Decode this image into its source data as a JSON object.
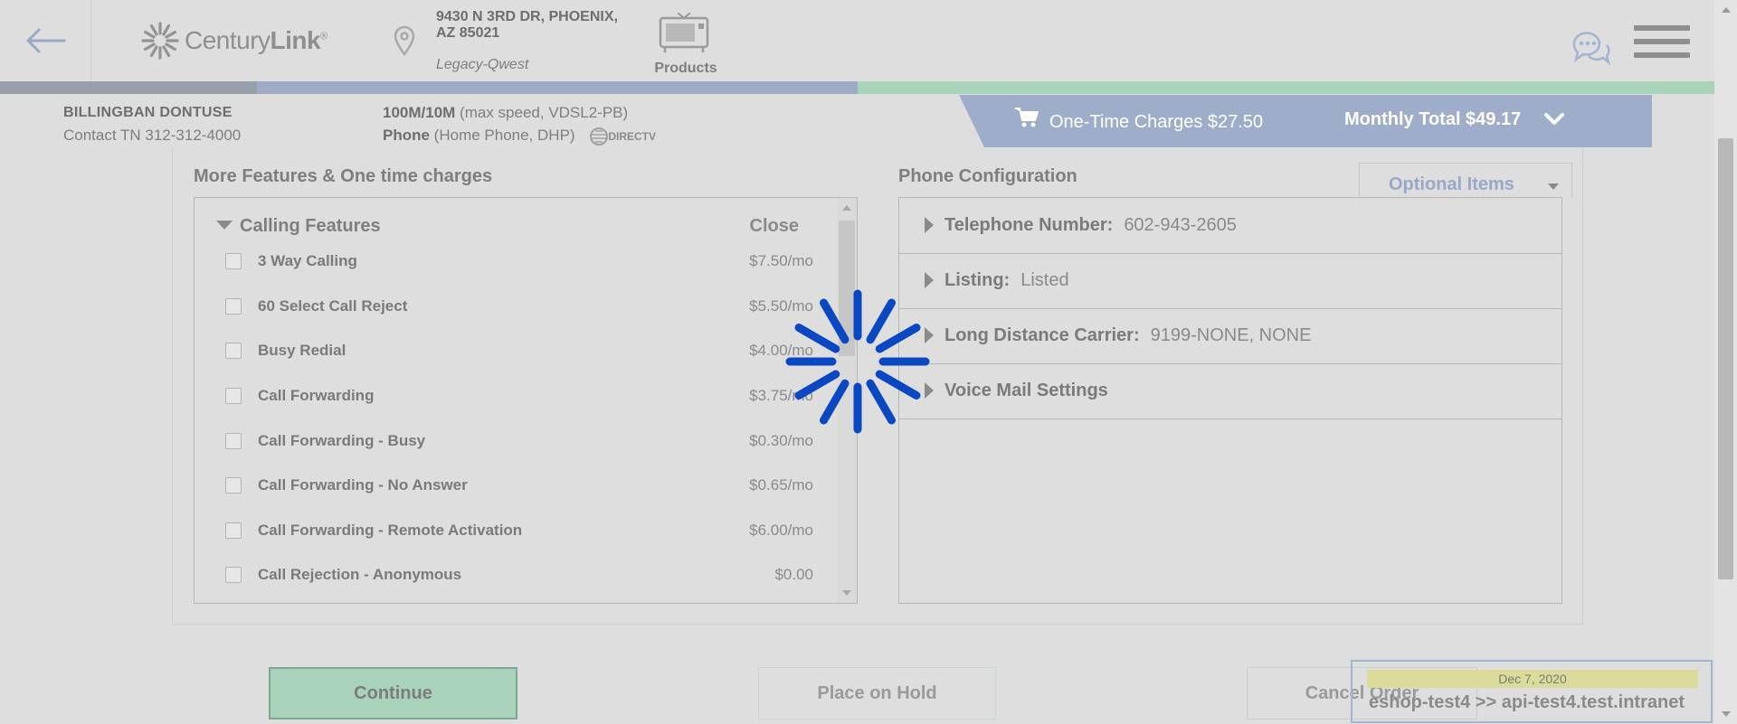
{
  "header": {
    "logo": {
      "text_normal": "Century",
      "text_bold": "Link",
      "mark": "®"
    },
    "address_line1": "9430 N 3RD DR, PHOENIX,",
    "address_line2": "AZ 85021",
    "account_type": "Legacy-Qwest",
    "products_label": "Products"
  },
  "customer": {
    "name": "BILLINGBAN DONTUSE",
    "contact": "Contact TN 312-312-4000",
    "service1_bold": "100M/10M",
    "service1_rest": " (max speed, VDSL2-PB)",
    "service2_bold": "Phone",
    "service2_rest": " (Home Phone, DHP)",
    "directv": "DIRECTV"
  },
  "charges": {
    "one_time": "One-Time Charges $27.50",
    "monthly_total": "Monthly Total $49.17"
  },
  "features_section": {
    "title": "More Features & One time charges",
    "group_label": "Calling Features",
    "close_label": "Close",
    "items": [
      {
        "name": "3 Way Calling",
        "price": "$7.50/mo"
      },
      {
        "name": "60 Select Call Reject",
        "price": "$5.50/mo"
      },
      {
        "name": "Busy Redial",
        "price": "$4.00/mo"
      },
      {
        "name": "Call Forwarding",
        "price": "$3.75/mo"
      },
      {
        "name": "Call Forwarding - Busy",
        "price": "$0.30/mo"
      },
      {
        "name": "Call Forwarding - No Answer",
        "price": "$0.65/mo"
      },
      {
        "name": "Call Forwarding - Remote Activation",
        "price": "$6.00/mo"
      },
      {
        "name": "Call Rejection - Anonymous",
        "price": "$0.00"
      }
    ]
  },
  "phone_config": {
    "title": "Phone Configuration",
    "optional_items": "Optional Items",
    "rows": [
      {
        "label": "Telephone Number:",
        "value": "602-943-2605"
      },
      {
        "label": "Listing:",
        "value": "Listed"
      },
      {
        "label": "Long Distance Carrier:",
        "value": "9199-NONE, NONE"
      },
      {
        "label": "Voice Mail Settings",
        "value": ""
      }
    ]
  },
  "footer": {
    "continue": "Continue",
    "hold": "Place on Hold",
    "cancel": "Cancel Order"
  },
  "env": {
    "date": "Dec 7, 2020",
    "host": "eshop-test4 >> api-test4.test.intranet"
  },
  "colors": {
    "spinner": "#0a47c2",
    "charges_bar": "#9eadc9",
    "continue_bg": "#a8d2ba",
    "overlay_bg": "#dedede"
  },
  "icons": [
    "back-arrow-icon",
    "centurylink-logo-icon",
    "location-pin-icon",
    "products-icon",
    "chat-icon",
    "hamburger-menu-icon",
    "cart-icon",
    "chevron-down-icon",
    "loading-spinner-icon"
  ]
}
